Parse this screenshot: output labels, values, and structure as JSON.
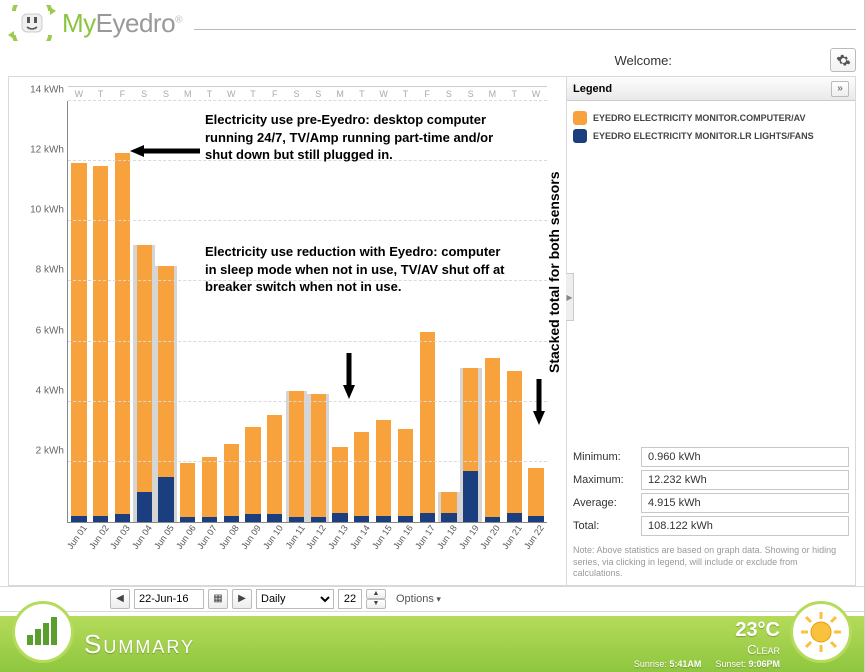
{
  "brand": {
    "my": "My",
    "eyedro": "Eyedro"
  },
  "welcome_label": "Welcome:",
  "legend": {
    "title": "Legend",
    "series": [
      {
        "label": "EYEDRO ELECTRICITY MONITOR.COMPUTER/AV",
        "color": "orange"
      },
      {
        "label": "EYEDRO ELECTRICITY MONITOR.LR LIGHTS/FANS",
        "color": "blue"
      }
    ]
  },
  "stats": {
    "min_label": "Minimum:",
    "min_val": "0.960 kWh",
    "max_label": "Maximum:",
    "max_val": "12.232 kWh",
    "avg_label": "Average:",
    "avg_val": "4.915 kWh",
    "tot_label": "Total:",
    "tot_val": "108.122 kWh"
  },
  "note": "Note: Above statistics are based on graph data. Showing or hiding series, via clicking in legend, will include or exclude from calculations.",
  "toolbar": {
    "date": "22-Jun-16",
    "granularity": "Daily",
    "count": "22",
    "options": "Options"
  },
  "annotations": {
    "pre": "Electricity use pre-Eyedro: desktop computer running 24/7, TV/Amp running part-time and/or shut down but still plugged in.",
    "post": "Electricity use reduction with Eyedro: computer in sleep mode when not in use, TV/AV shut off at breaker switch when not in use.",
    "stacked": "Stacked total for both sensors"
  },
  "summary": {
    "title": "Summary",
    "temp": "23°C",
    "cond": "Clear",
    "sunrise_lbl": "Sunrise:",
    "sunrise": "5:41AM",
    "sunset_lbl": "Sunset:",
    "sunset": "9:06PM"
  },
  "chart_data": {
    "type": "bar",
    "title": "",
    "xlabel": "",
    "ylabel": "kWh",
    "ylim": [
      0,
      14
    ],
    "yticks": [
      0,
      2,
      4,
      6,
      8,
      10,
      12,
      14
    ],
    "ytick_labels": [
      "",
      "2 kWh",
      "4 kWh",
      "6 kWh",
      "8 kWh",
      "10 kWh",
      "12 kWh",
      "14 kWh"
    ],
    "categories": [
      "Jun 01",
      "Jun 02",
      "Jun 03",
      "Jun 04",
      "Jun 05",
      "Jun 06",
      "Jun 07",
      "Jun 08",
      "Jun 09",
      "Jun 10",
      "Jun 11",
      "Jun 12",
      "Jun 13",
      "Jun 14",
      "Jun 15",
      "Jun 16",
      "Jun 17",
      "Jun 18",
      "Jun 19",
      "Jun 20",
      "Jun 21",
      "Jun 22"
    ],
    "days_of_week": [
      "W",
      "T",
      "F",
      "S",
      "S",
      "M",
      "T",
      "W",
      "T",
      "F",
      "S",
      "S",
      "M",
      "T",
      "W",
      "T",
      "F",
      "S",
      "S",
      "M",
      "T",
      "W"
    ],
    "weekend_idx": [
      3,
      4,
      10,
      11,
      17,
      18
    ],
    "series": [
      {
        "name": "EYEDRO ELECTRICITY MONITOR.COMPUTER/AV",
        "color": "orange",
        "values": [
          11.7,
          11.6,
          12.0,
          8.2,
          7.0,
          1.8,
          2.0,
          2.4,
          2.9,
          3.3,
          4.2,
          4.1,
          2.2,
          2.8,
          3.2,
          2.9,
          6.0,
          0.7,
          3.4,
          5.3,
          4.7,
          1.6
        ]
      },
      {
        "name": "EYEDRO ELECTRICITY MONITOR.LR LIGHTS/FANS",
        "color": "blue",
        "values": [
          0.2,
          0.2,
          0.25,
          1.0,
          1.5,
          0.15,
          0.15,
          0.2,
          0.25,
          0.25,
          0.15,
          0.15,
          0.3,
          0.2,
          0.2,
          0.2,
          0.3,
          0.3,
          1.7,
          0.15,
          0.3,
          0.2
        ]
      }
    ]
  }
}
